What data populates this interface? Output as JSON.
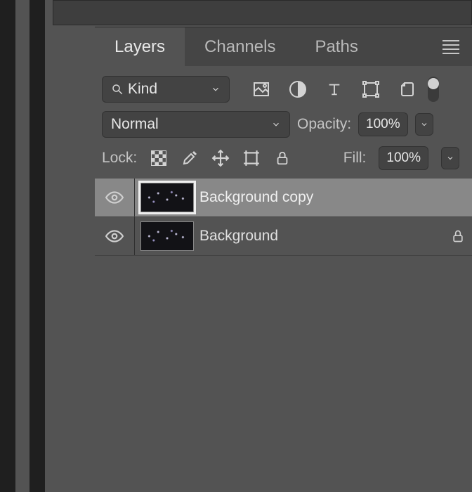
{
  "tabs": {
    "layers": "Layers",
    "channels": "Channels",
    "paths": "Paths"
  },
  "filter": {
    "label": "Kind"
  },
  "blend": {
    "mode": "Normal",
    "opacity_label": "Opacity:",
    "opacity_value": "100%"
  },
  "lock": {
    "label": "Lock:",
    "fill_label": "Fill:",
    "fill_value": "100%"
  },
  "layers": [
    {
      "name": "Background copy",
      "locked": false,
      "selected": true
    },
    {
      "name": "Background",
      "locked": true,
      "selected": false
    }
  ]
}
